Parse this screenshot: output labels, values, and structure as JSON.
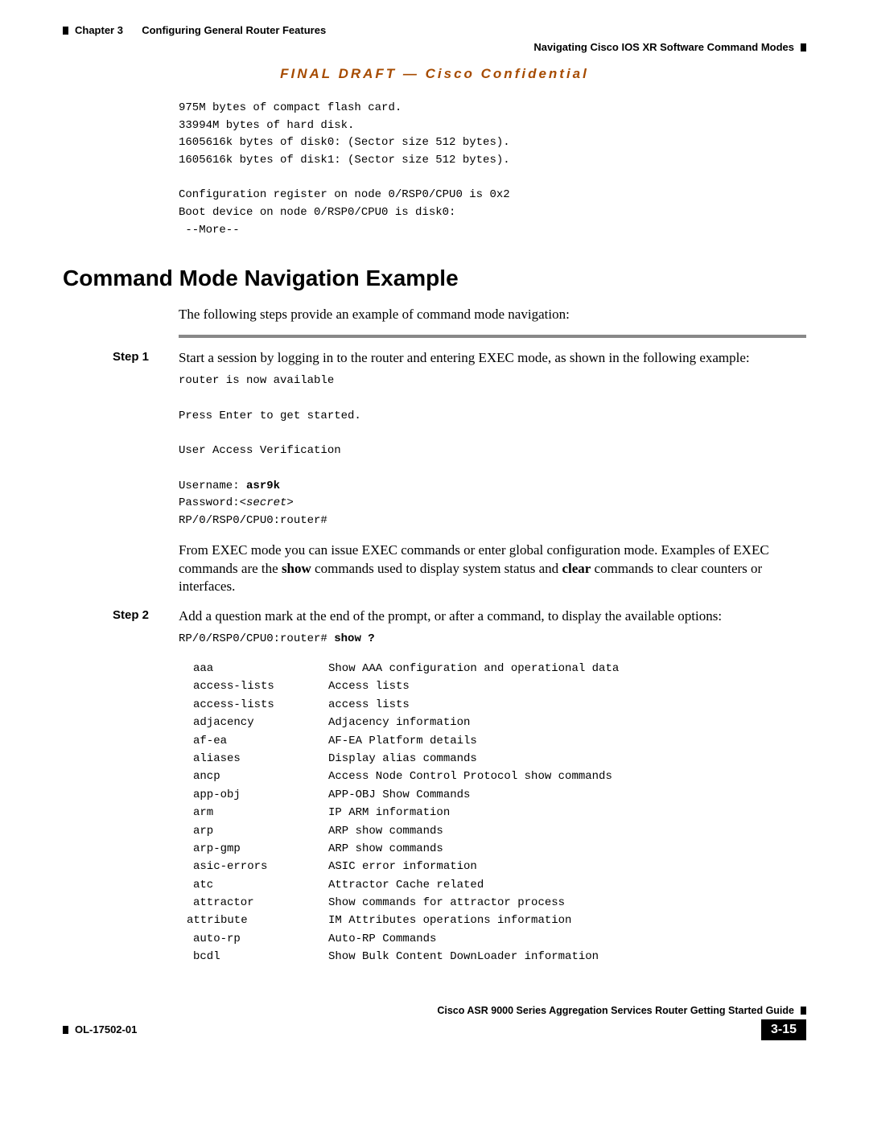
{
  "header": {
    "chapter": "Chapter 3",
    "chapter_title": "Configuring General Router Features",
    "section": "Navigating Cisco IOS XR Software Command Modes"
  },
  "banner": "FINAL DRAFT — Cisco Confidential",
  "intro_block": "975M bytes of compact flash card.\n33994M bytes of hard disk.\n1605616k bytes of disk0: (Sector size 512 bytes).\n1605616k bytes of disk1: (Sector size 512 bytes).\n\nConfiguration register on node 0/RSP0/CPU0 is 0x2\nBoot device on node 0/RSP0/CPU0 is disk0:\n --More--",
  "h2": "Command Mode Navigation Example",
  "lead": "The following steps provide an example of command mode navigation:",
  "step1": {
    "label": "Step 1",
    "text": "Start a session by logging in to the router and entering EXEC mode, as shown in the following example:",
    "code_l1": "router is now available",
    "code_l2": "Press Enter to get started.",
    "code_l3": "User Access Verification",
    "code_l4_pre": "Username: ",
    "code_l4_bold": "asr9k",
    "code_l5_pre": "Password:",
    "code_l5_it": "<secret>",
    "code_l6": "RP/0/RSP0/CPU0:router#",
    "after_pre": "From EXEC mode you can issue EXEC commands or enter global configuration mode. Examples of EXEC commands are the ",
    "after_b1": "show",
    "after_mid": " commands used to display system status and ",
    "after_b2": "clear",
    "after_post": " commands to clear counters or interfaces."
  },
  "step2": {
    "label": "Step 2",
    "text": "Add a question mark at the end of the prompt, or after a command, to display the available options:",
    "prompt_pre": "RP/0/RSP0/CPU0:router# ",
    "prompt_bold": "show ?"
  },
  "show_list": [
    {
      "cmd": "aaa",
      "desc": "Show AAA configuration and operational data"
    },
    {
      "cmd": "access-lists",
      "desc": "Access lists"
    },
    {
      "cmd": "access-lists",
      "desc": "access lists"
    },
    {
      "cmd": "adjacency",
      "desc": "Adjacency information"
    },
    {
      "cmd": "af-ea",
      "desc": "AF-EA Platform details"
    },
    {
      "cmd": "aliases",
      "desc": "Display alias commands"
    },
    {
      "cmd": "ancp",
      "desc": "Access Node Control Protocol show commands"
    },
    {
      "cmd": "app-obj",
      "desc": "APP-OBJ Show Commands"
    },
    {
      "cmd": "arm",
      "desc": "IP ARM information"
    },
    {
      "cmd": "arp",
      "desc": "ARP show commands"
    },
    {
      "cmd": "arp-gmp",
      "desc": "ARP show commands"
    },
    {
      "cmd": "asic-errors",
      "desc": "ASIC error information"
    },
    {
      "cmd": "atc",
      "desc": "Attractor Cache related"
    },
    {
      "cmd": "attractor",
      "desc": "Show commands for attractor process"
    },
    {
      "cmd": "attribute",
      "desc": "IM Attributes operations information",
      "noindent": true
    },
    {
      "cmd": "auto-rp",
      "desc": "Auto-RP Commands"
    },
    {
      "cmd": "bcdl",
      "desc": "Show Bulk Content DownLoader information"
    }
  ],
  "footer": {
    "guide": "Cisco ASR 9000 Series Aggregation Services Router Getting Started Guide",
    "doc": "OL-17502-01",
    "page": "3-15"
  }
}
